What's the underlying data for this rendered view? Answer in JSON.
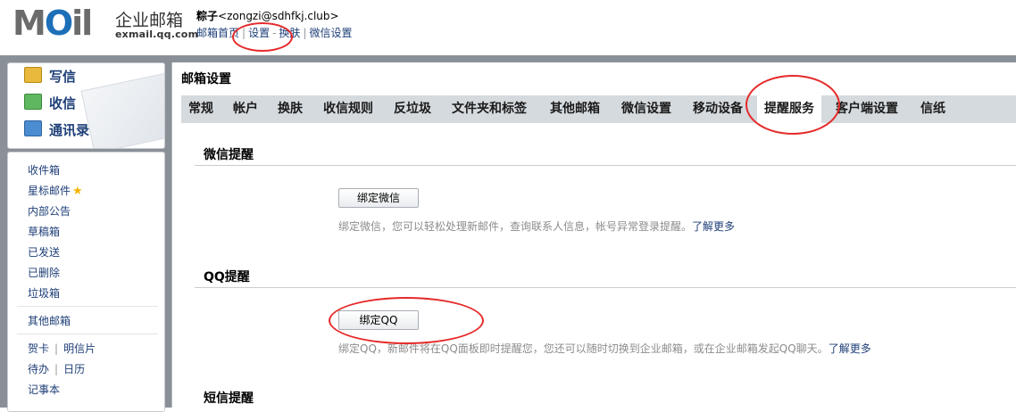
{
  "header": {
    "logo_word_pre": "M",
    "logo_word_o": "O",
    "logo_word_post": "il",
    "logo_cn": "企业邮箱",
    "logo_domain": "exmail.qq.com",
    "user_name": "粽子",
    "user_email": "<zongzi@sdhfkj.club>",
    "links": [
      "邮箱首页",
      "设置",
      "换肤",
      "微信设置"
    ],
    "separators": [
      "|",
      "-",
      "|"
    ]
  },
  "sidebar": {
    "quick": [
      {
        "label": "写信",
        "icon": "pencil-icon"
      },
      {
        "label": "收信",
        "icon": "inbox-icon"
      },
      {
        "label": "通讯录",
        "icon": "contacts-icon"
      }
    ],
    "folders": [
      "收件箱",
      "星标邮件",
      "内部公告",
      "草稿箱",
      "已发送",
      "已删除",
      "垃圾箱"
    ],
    "other_mailbox": "其他邮箱",
    "tools_row1": [
      "贺卡",
      "明信片"
    ],
    "tools_row2": [
      "待办",
      "日历"
    ],
    "notebook": "记事本",
    "tool_separator": "|"
  },
  "main": {
    "title": "邮箱设置",
    "tabs": [
      "常规",
      "帐户",
      "换肤",
      "收信规则",
      "反垃圾",
      "文件夹和标签",
      "其他邮箱",
      "微信设置",
      "移动设备",
      "提醒服务",
      "客户端设置",
      "信纸"
    ],
    "active_tab": "提醒服务",
    "sections": [
      {
        "title": "微信提醒",
        "button": "绑定微信",
        "desc": "绑定微信，您可以轻松处理新邮件，查询联系人信息，帐号异常登录提醒。",
        "more": "了解更多"
      },
      {
        "title": "QQ提醒",
        "button": "绑定QQ",
        "desc": "绑定QQ，新邮件将在QQ面板即时提醒您，您还可以随时切换到企业邮箱，或在企业邮箱发起QQ聊天。",
        "more": "了解更多"
      },
      {
        "title": "短信提醒"
      }
    ]
  },
  "colors": {
    "link": "#1e3f78",
    "annotation": "#e62a2a",
    "tabbar": "#d5dade",
    "frame": "#8a9097"
  }
}
